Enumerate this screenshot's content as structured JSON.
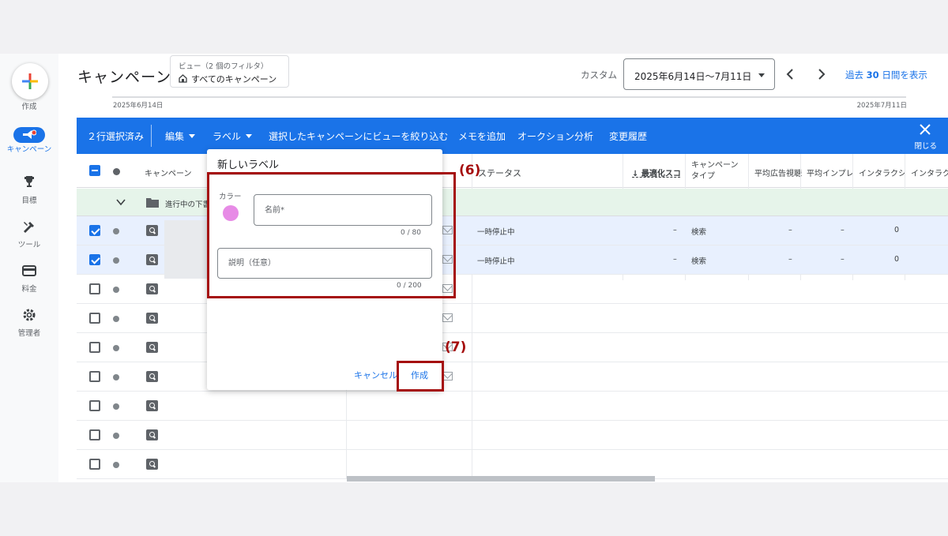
{
  "rail": {
    "create_label": "作成",
    "items": [
      {
        "label": "キャンペーン",
        "icon": "megaphone-icon"
      },
      {
        "label": "目標",
        "icon": "trophy-icon"
      },
      {
        "label": "ツール",
        "icon": "tools-icon"
      },
      {
        "label": "料金",
        "icon": "credit-card-icon"
      },
      {
        "label": "管理者",
        "icon": "gear-icon"
      }
    ]
  },
  "header": {
    "title": "キャンペーン",
    "view_sub": "ビュー（2 個のフィルタ）",
    "view_main": "すべてのキャンペーン",
    "custom_label": "カスタム",
    "date_range": "2025年6月14日〜7月11日",
    "past_prefix": "過去",
    "past_num": "30",
    "past_suffix": "日間を表示"
  },
  "timeline": {
    "start": "2025年6月14日",
    "end": "2025年7月11日"
  },
  "actionbar": {
    "selected": "２行選択済み",
    "edit": "編集",
    "label": "ラベル",
    "filter_view": "選択したキャンペーンにビューを絞り込む",
    "add_memo": "メモを追加",
    "auction": "オークション分析",
    "history": "変更履歴",
    "close": "閉じる"
  },
  "table": {
    "headers": {
      "campaign": "キャンペーン",
      "status": "ステータス",
      "opt_score": "↓ 最適化スコ",
      "type_line1": "キャンペーン",
      "type_line2": "タイプ",
      "c1": "平均広告視聴",
      "c2": "平均インプレ",
      "c3": "インタラクシ",
      "c4": "インタラクシ"
    },
    "group_label": "進行中の下書",
    "rows": [
      {
        "selected": true,
        "status": "一時停止中",
        "opt": "–",
        "type": "検索",
        "c1": "–",
        "c2": "–",
        "c3": "0"
      },
      {
        "selected": true,
        "status": "一時停止中",
        "opt": "–",
        "type": "検索",
        "c1": "–",
        "c2": "–",
        "c3": "0"
      },
      {
        "selected": false
      },
      {
        "selected": false
      },
      {
        "selected": false
      },
      {
        "selected": false
      },
      {
        "selected": false
      },
      {
        "selected": false
      },
      {
        "selected": false
      }
    ]
  },
  "dialog": {
    "title": "新しいラベル",
    "color_label": "カラー",
    "color_value": "#e78be6",
    "name_placeholder": "名前*",
    "name_counter": "0 / 80",
    "desc_placeholder": "説明（任意）",
    "desc_counter": "0 / 200",
    "cancel": "キャンセル",
    "create": "作成"
  },
  "annotations": {
    "step6": "(6)",
    "step7": "(7)"
  }
}
